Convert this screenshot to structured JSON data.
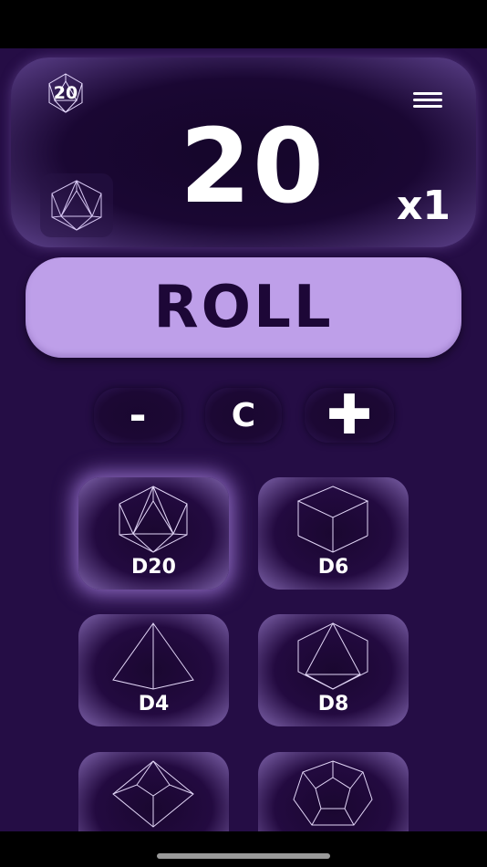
{
  "header": {
    "badge_label": "20",
    "menu_icon": "hamburger-menu-icon",
    "current_die_icon": "d20-icon"
  },
  "result": {
    "value": "20",
    "multiplier": "x1"
  },
  "roll_button": {
    "label": "ROLL"
  },
  "controls": {
    "minus_label": "-",
    "clear_label": "C",
    "plus_label": "✚"
  },
  "dice": [
    {
      "label": "D20",
      "icon": "d20-icon",
      "selected": true
    },
    {
      "label": "D6",
      "icon": "d6-icon",
      "selected": false
    },
    {
      "label": "D4",
      "icon": "d4-icon",
      "selected": false
    },
    {
      "label": "D8",
      "icon": "d8-icon",
      "selected": false
    },
    {
      "label": "",
      "icon": "d10-icon",
      "selected": false
    },
    {
      "label": "",
      "icon": "d12-icon",
      "selected": false
    }
  ],
  "colors": {
    "background": "#250d45",
    "accent": "#be9fe9",
    "button_text": "#1d0737",
    "text": "#ffffff"
  }
}
